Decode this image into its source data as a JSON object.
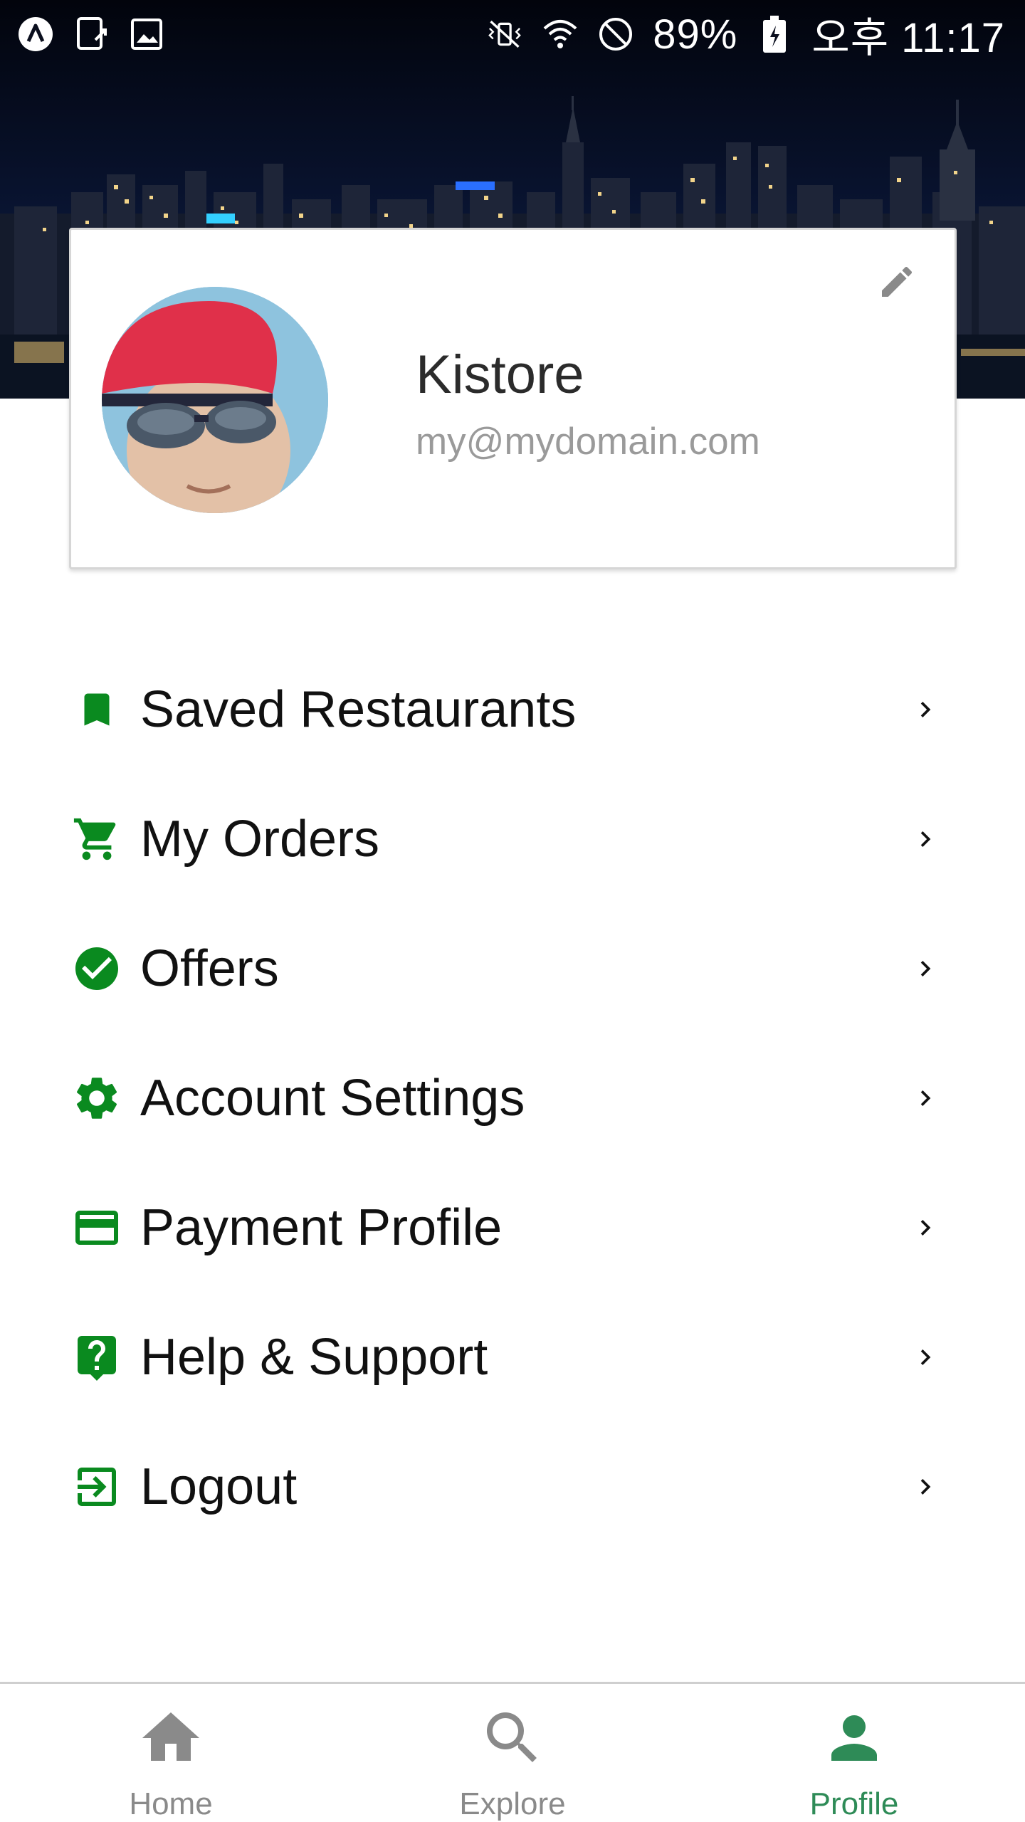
{
  "status_bar": {
    "battery": "89%",
    "time": "오후 11:17",
    "left_icons": [
      "app-icon",
      "screen-share-icon",
      "image-icon"
    ],
    "right_icons": [
      "vibrate-icon",
      "wifi-icon",
      "do-not-disturb-icon",
      "battery-icon"
    ]
  },
  "profile": {
    "name": "Kistore",
    "email": "my@mydomain.com",
    "edit_icon": "pencil-icon"
  },
  "menu": {
    "items": [
      {
        "label": "Saved Restaurants",
        "icon": "bookmark-icon"
      },
      {
        "label": "My Orders",
        "icon": "cart-icon"
      },
      {
        "label": "Offers",
        "icon": "check-circle-icon"
      },
      {
        "label": "Account Settings",
        "icon": "gear-icon"
      },
      {
        "label": "Payment Profile",
        "icon": "credit-card-icon"
      },
      {
        "label": "Help & Support",
        "icon": "help-icon"
      },
      {
        "label": "Logout",
        "icon": "logout-icon"
      }
    ]
  },
  "bottom_nav": {
    "items": [
      {
        "label": "Home",
        "icon": "home-icon",
        "active": false
      },
      {
        "label": "Explore",
        "icon": "search-icon",
        "active": false
      },
      {
        "label": "Profile",
        "icon": "person-icon",
        "active": true
      }
    ]
  },
  "colors": {
    "accent_green": "#0a8a1f",
    "active_tab": "#2e8b57",
    "inactive_tab": "#8a8a8a",
    "header_bg": "#07102a"
  }
}
